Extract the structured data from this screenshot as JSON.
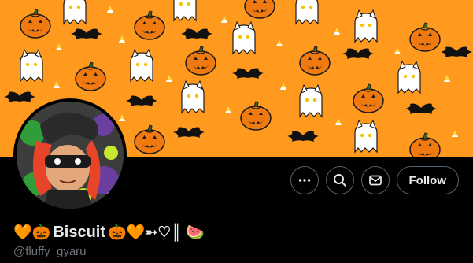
{
  "profile": {
    "display_name": "Biscuit",
    "name_prefix_emoji": "🧡🎃",
    "name_suffix_emoji": "🎃🧡➵♡║ 🍉",
    "handle": "@fluffy_gyaru"
  },
  "actions": {
    "more_icon": "more-icon",
    "search_icon": "search-icon",
    "message_icon": "message-icon",
    "follow_label": "Follow"
  },
  "banner": {
    "theme": "halloween pattern",
    "background_color": "#ff9a1f"
  }
}
